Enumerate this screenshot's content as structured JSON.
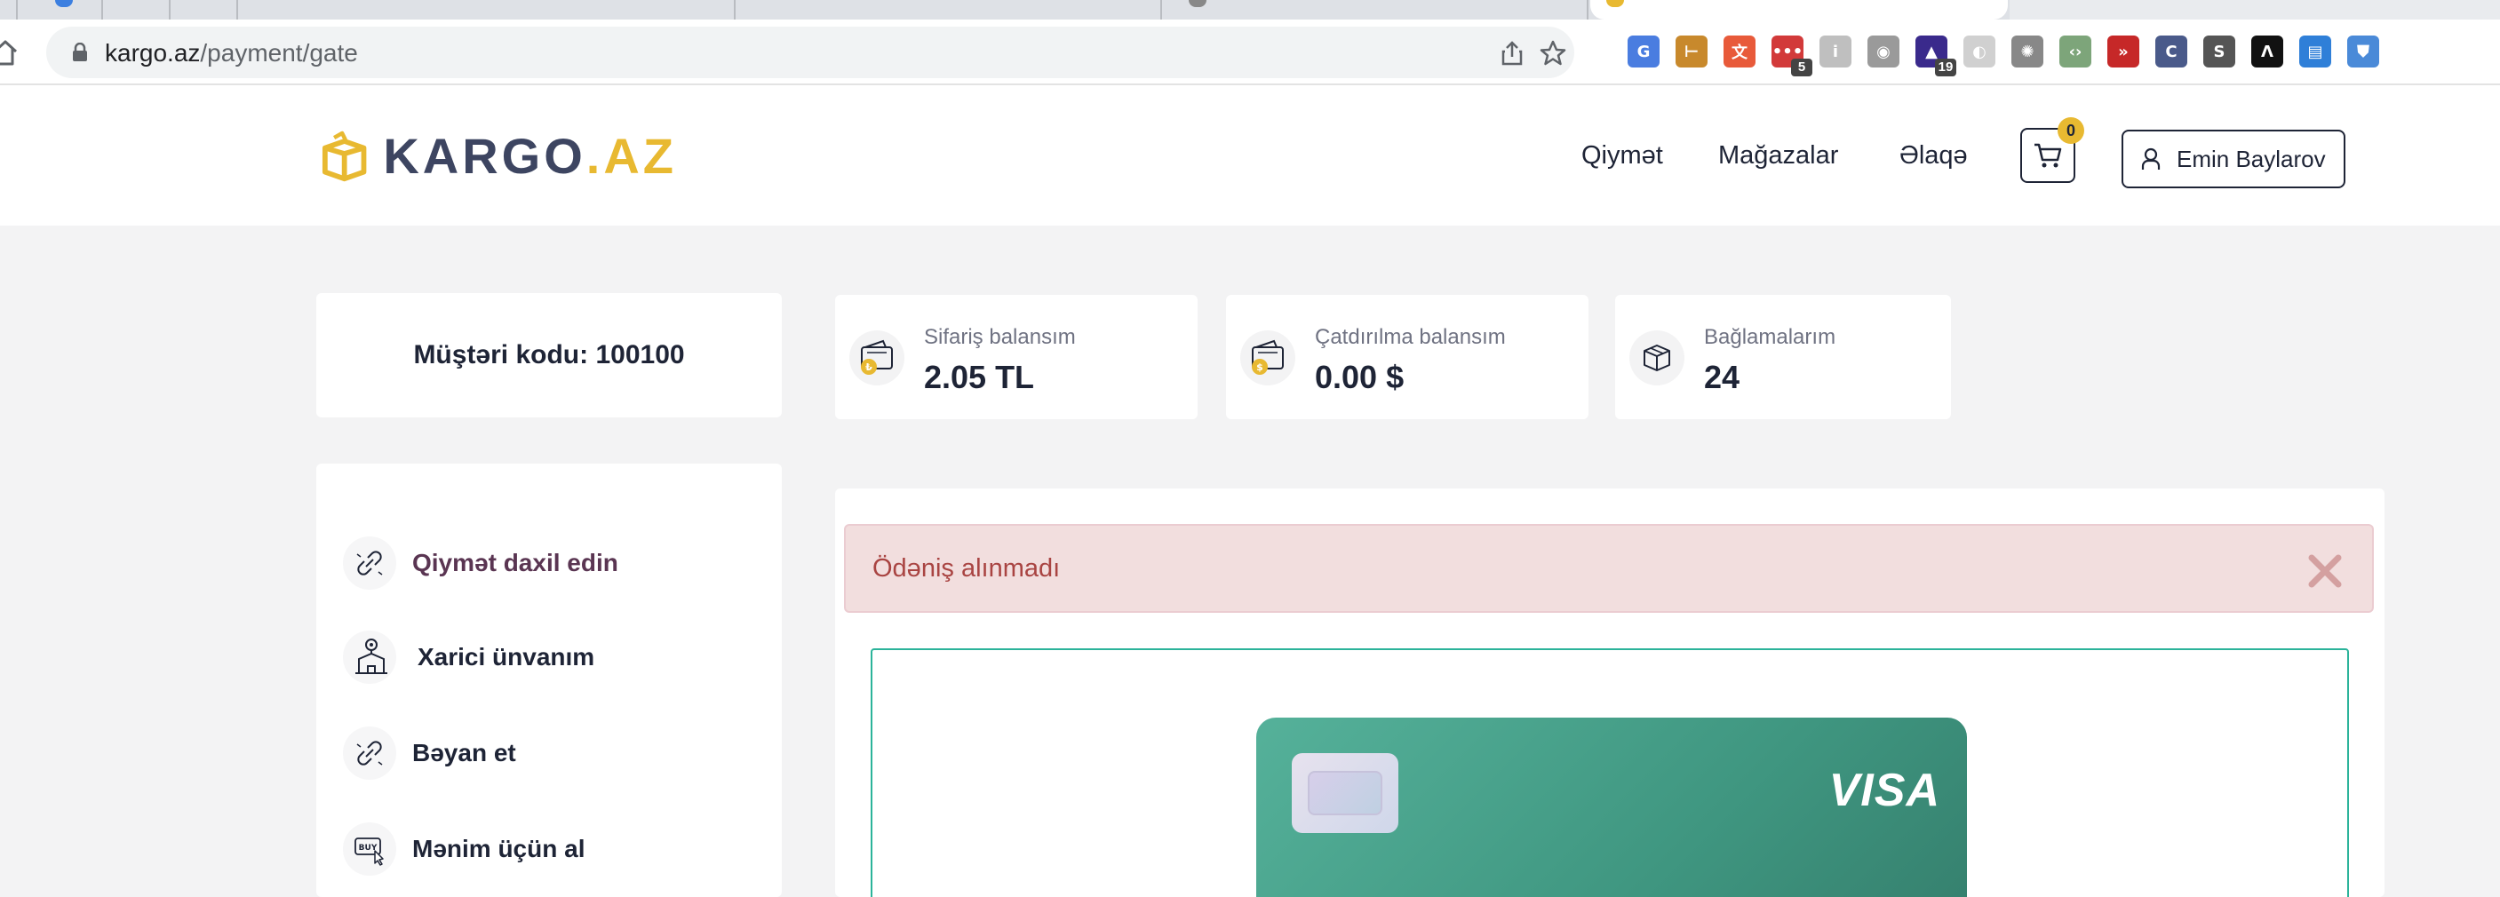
{
  "browser": {
    "url_domain": "kargo.az",
    "url_path": "/payment/gate",
    "extensions": [
      {
        "name": "google-translate-icon",
        "color": "#4a7de0",
        "glyph": "G"
      },
      {
        "name": "ruler-icon",
        "color": "#c8892c",
        "glyph": "⊢"
      },
      {
        "name": "language-ext-icon",
        "color": "#e85a3a",
        "glyph": "文"
      },
      {
        "name": "todo-ext-icon",
        "color": "#d23a3a",
        "glyph": "•••",
        "badge": "5"
      },
      {
        "name": "info-ext-icon",
        "color": "#bfbfbf",
        "glyph": "i"
      },
      {
        "name": "camera-icon",
        "color": "#9a9a9a",
        "glyph": "◉"
      },
      {
        "name": "graduation-cap-icon",
        "color": "#3a2a8c",
        "glyph": "▲",
        "badge": "19"
      },
      {
        "name": "circle-ext-icon",
        "color": "#d0d0d0",
        "glyph": "◐"
      },
      {
        "name": "settings-ext-icon",
        "color": "#888888",
        "glyph": "✺"
      },
      {
        "name": "code-ext-icon",
        "color": "#7da57a",
        "glyph": "‹›"
      },
      {
        "name": "fast-forward-ext-icon",
        "color": "#c62828",
        "glyph": "»"
      },
      {
        "name": "c-ext-icon",
        "color": "#4a5a8a",
        "glyph": "C"
      },
      {
        "name": "s-ext-icon",
        "color": "#555555",
        "glyph": "S"
      },
      {
        "name": "triangle-ext-icon",
        "color": "#111111",
        "glyph": "Λ"
      },
      {
        "name": "outlook-ext-icon",
        "color": "#2f7fd8",
        "glyph": "▤"
      },
      {
        "name": "shield-ext-icon",
        "color": "#4a8ad8",
        "glyph": "⛊"
      }
    ]
  },
  "header": {
    "logo_main": "KARGO",
    "logo_tld": ".AZ",
    "nav": [
      "Qiymət",
      "Mağazalar",
      "Əlaqə"
    ],
    "cart_count": "0",
    "user_name": "Emin Baylarov"
  },
  "stats": {
    "customer_code_label": "Müştəri kodu:",
    "customer_code": "100100",
    "order_balance_label": "Sifariş balansım",
    "order_balance_value": "2.05 TL",
    "delivery_balance_label": "Çatdırılma balansım",
    "delivery_balance_value": "0.00 $",
    "parcels_label": "Bağlamalarım",
    "parcels_value": "24"
  },
  "sidebar": {
    "items": [
      {
        "label": "Qiymət daxil edin"
      },
      {
        "label": "Xarici ünvanım"
      },
      {
        "label": "Bəyan et"
      },
      {
        "label": "Mənim üçün al"
      }
    ]
  },
  "main": {
    "alert_text": "Ödəniş alınmadı",
    "card_brand": "VISA"
  },
  "colors": {
    "brand_dark": "#3d4561",
    "brand_yellow": "#e8b931",
    "alert_bg": "#f2dede",
    "alert_text": "#a94442",
    "card_green": "#4ca48d"
  }
}
